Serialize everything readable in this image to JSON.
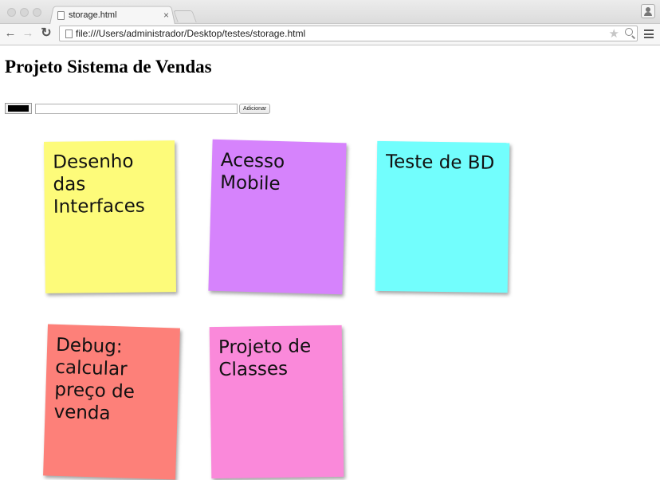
{
  "browser": {
    "tab_title": "storage.html",
    "tab_close": "×",
    "address": "file:///Users/administrador/Desktop/testes/storage.html",
    "back": "←",
    "forward": "→",
    "reload": "↻",
    "star": "★"
  },
  "page": {
    "heading": "Projeto Sistema de Vendas",
    "color_value": "#000000",
    "input_value": "",
    "add_button": "Adicionar"
  },
  "notes": [
    {
      "text": "Desenho das Interfaces",
      "color": "#fdfb7a"
    },
    {
      "text": "Acesso Mobile",
      "color": "#d683fc"
    },
    {
      "text": "Teste de BD",
      "color": "#72fefd"
    },
    {
      "text": "Debug: calcular preço de venda",
      "color": "#fd8079"
    },
    {
      "text": "Projeto de Classes",
      "color": "#fa89da"
    }
  ]
}
